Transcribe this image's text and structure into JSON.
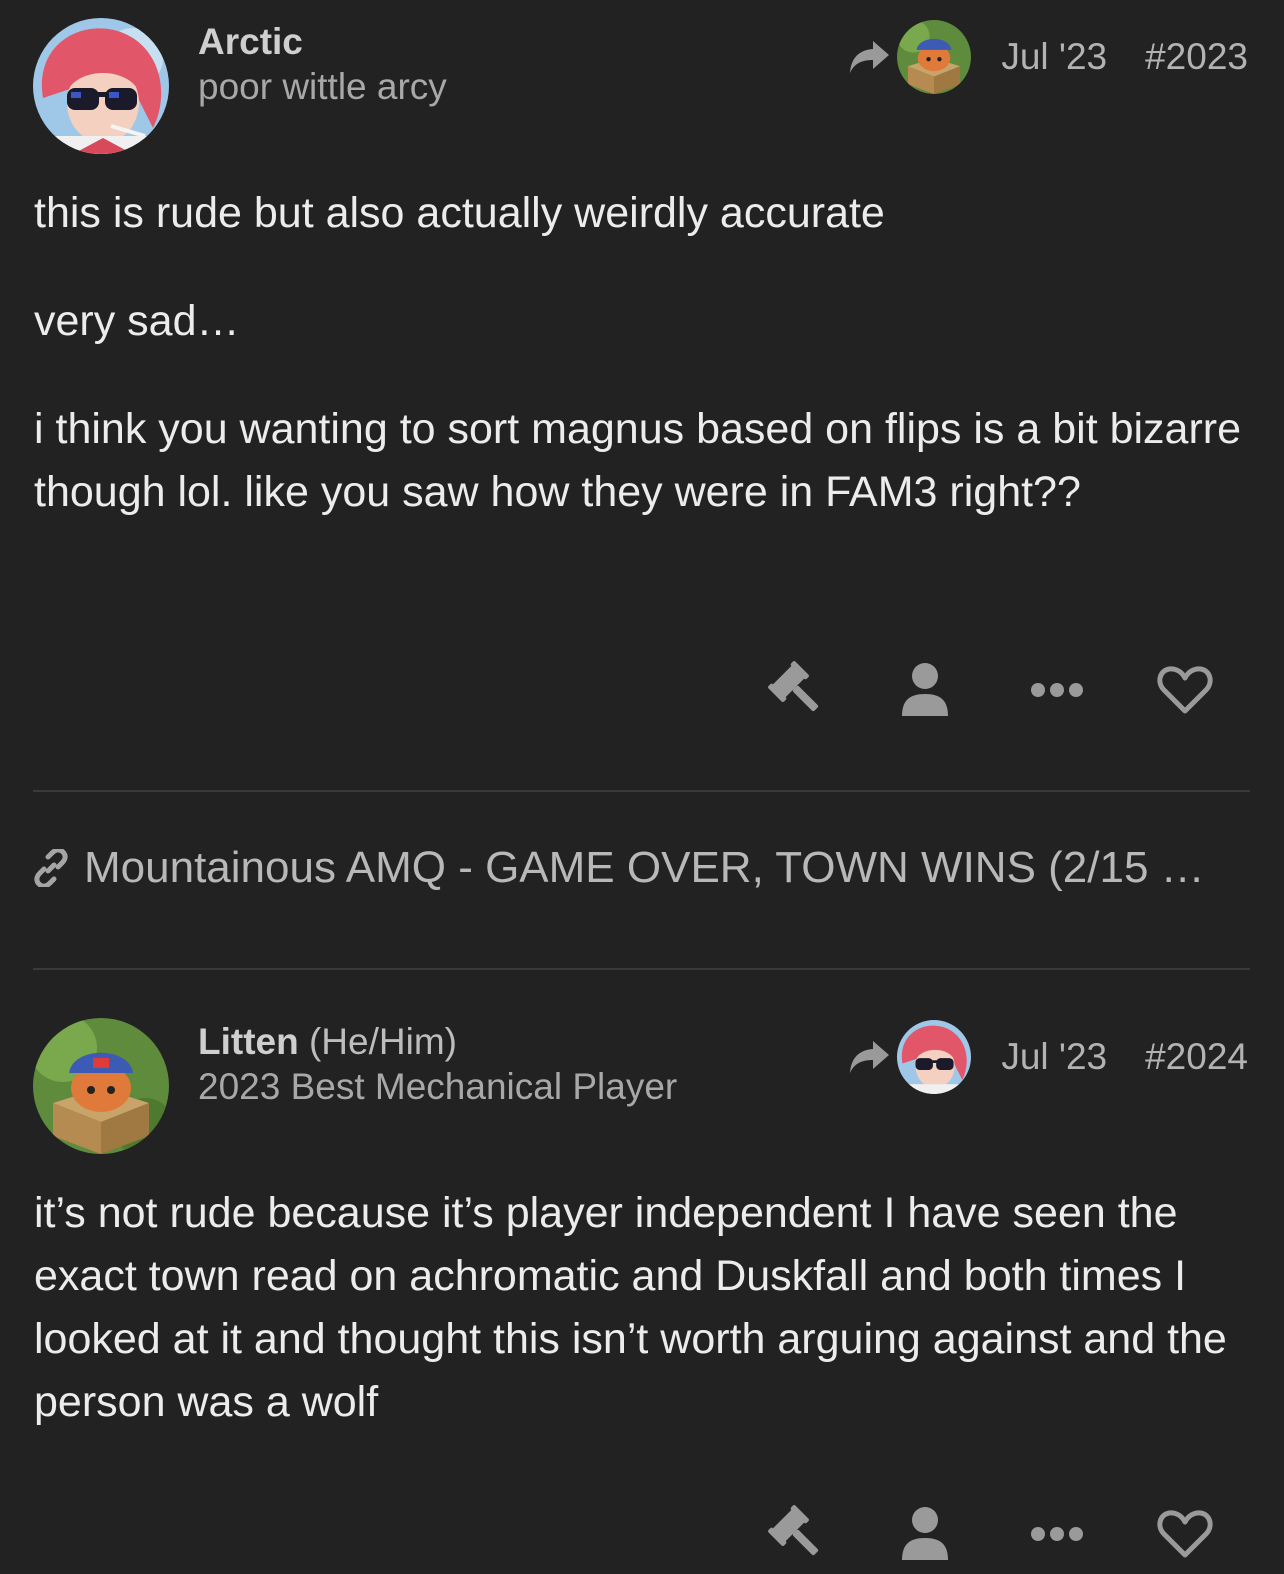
{
  "posts": [
    {
      "username": "Arctic",
      "pronouns": "",
      "user_title": "poor wittle arcy",
      "avatar_icon": "red-haired-sunglasses-avatar",
      "reply_to_avatar_icon": "cat-in-box-avatar",
      "date": "Jul '23",
      "number": "#2023",
      "paragraphs": [
        "this is rude but also actually weirdly accurate",
        "very sad…",
        "i think you wanting to sort magnus based on flips is a bit bizarre though lol. like you saw how they were in FAM3 right??"
      ]
    },
    {
      "username": "Litten",
      "pronouns": "(He/Him)",
      "user_title": "2023 Best Mechanical Player",
      "avatar_icon": "cat-in-box-avatar",
      "reply_to_avatar_icon": "red-haired-sunglasses-avatar",
      "date": "Jul '23",
      "number": "#2024",
      "paragraphs": [
        "it’s not rude because it’s player independent I have seen the exact town read on achromatic and Duskfall and both times I looked at it and thought this isn’t worth arguing against and the person was a wolf"
      ]
    }
  ],
  "linked_topic": {
    "title": "Mountainous AMQ - GAME OVER, TOWN WINS (2/15 …",
    "icon": "link-icon"
  },
  "actions": {
    "icons": [
      "gavel-icon",
      "user-icon",
      "more-icon",
      "heart-icon"
    ]
  },
  "colors": {
    "background": "#222222",
    "divider": "#3a3a3a",
    "icon": "#9a9a9a"
  }
}
